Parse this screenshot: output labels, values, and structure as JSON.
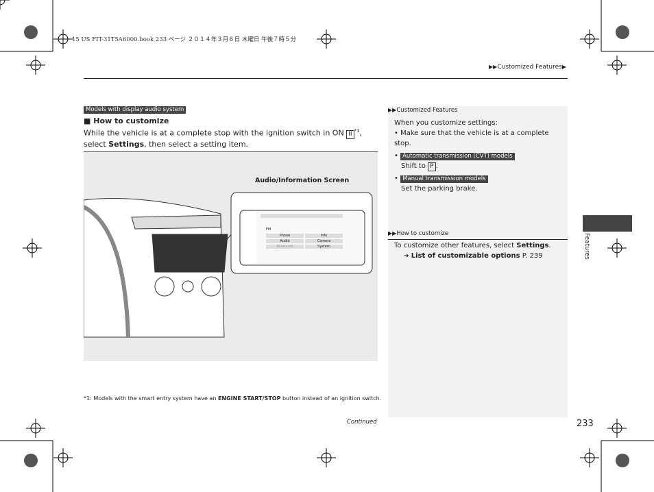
{
  "print_info": "15 US FIT-31T5A6000.book  233 ページ  ２０１４年３月６日  木曜日  午後７時５分",
  "header": {
    "breadcrumb": "Customized Features"
  },
  "main": {
    "model_tag": "Models with display audio system",
    "heading": "How to customize",
    "body_1": "While the vehicle is at a complete stop with the ignition switch in ON ",
    "key": "II",
    "footnote_ref": "*1",
    "body_2": ", select ",
    "body_bold": "Settings",
    "body_3": ", then select a setting item.",
    "figure": {
      "label": "Audio/Information Screen",
      "screen": {
        "source": "FM",
        "buttons": [
          "Phone",
          "Info",
          "Audio",
          "Camera",
          "Bluetooth",
          "System"
        ]
      }
    },
    "footnote": {
      "prefix": "*1: Models with the smart entry system have an ",
      "bold": "ENGINE START/STOP",
      "suffix": " button instead of an ignition switch."
    },
    "continued": "Continued",
    "page_number": "233"
  },
  "sidebar": {
    "section1_title": "Customized Features",
    "intro": "When you customize settings:",
    "bullet1": "Make sure that the vehicle is at a complete stop.",
    "bullet2_tag": "Automatic transmission (CVT) models",
    "bullet2_text": "Shift to ",
    "bullet2_key": "P",
    "bullet3_tag": "Manual transmission models",
    "bullet3_text": "Set the parking brake.",
    "section2_title": "How to customize",
    "text": "To customize other features, select ",
    "text_bold": "Settings",
    "link": "List of customizable options",
    "link_page": "P. 239"
  },
  "tab": {
    "label": "Features"
  }
}
